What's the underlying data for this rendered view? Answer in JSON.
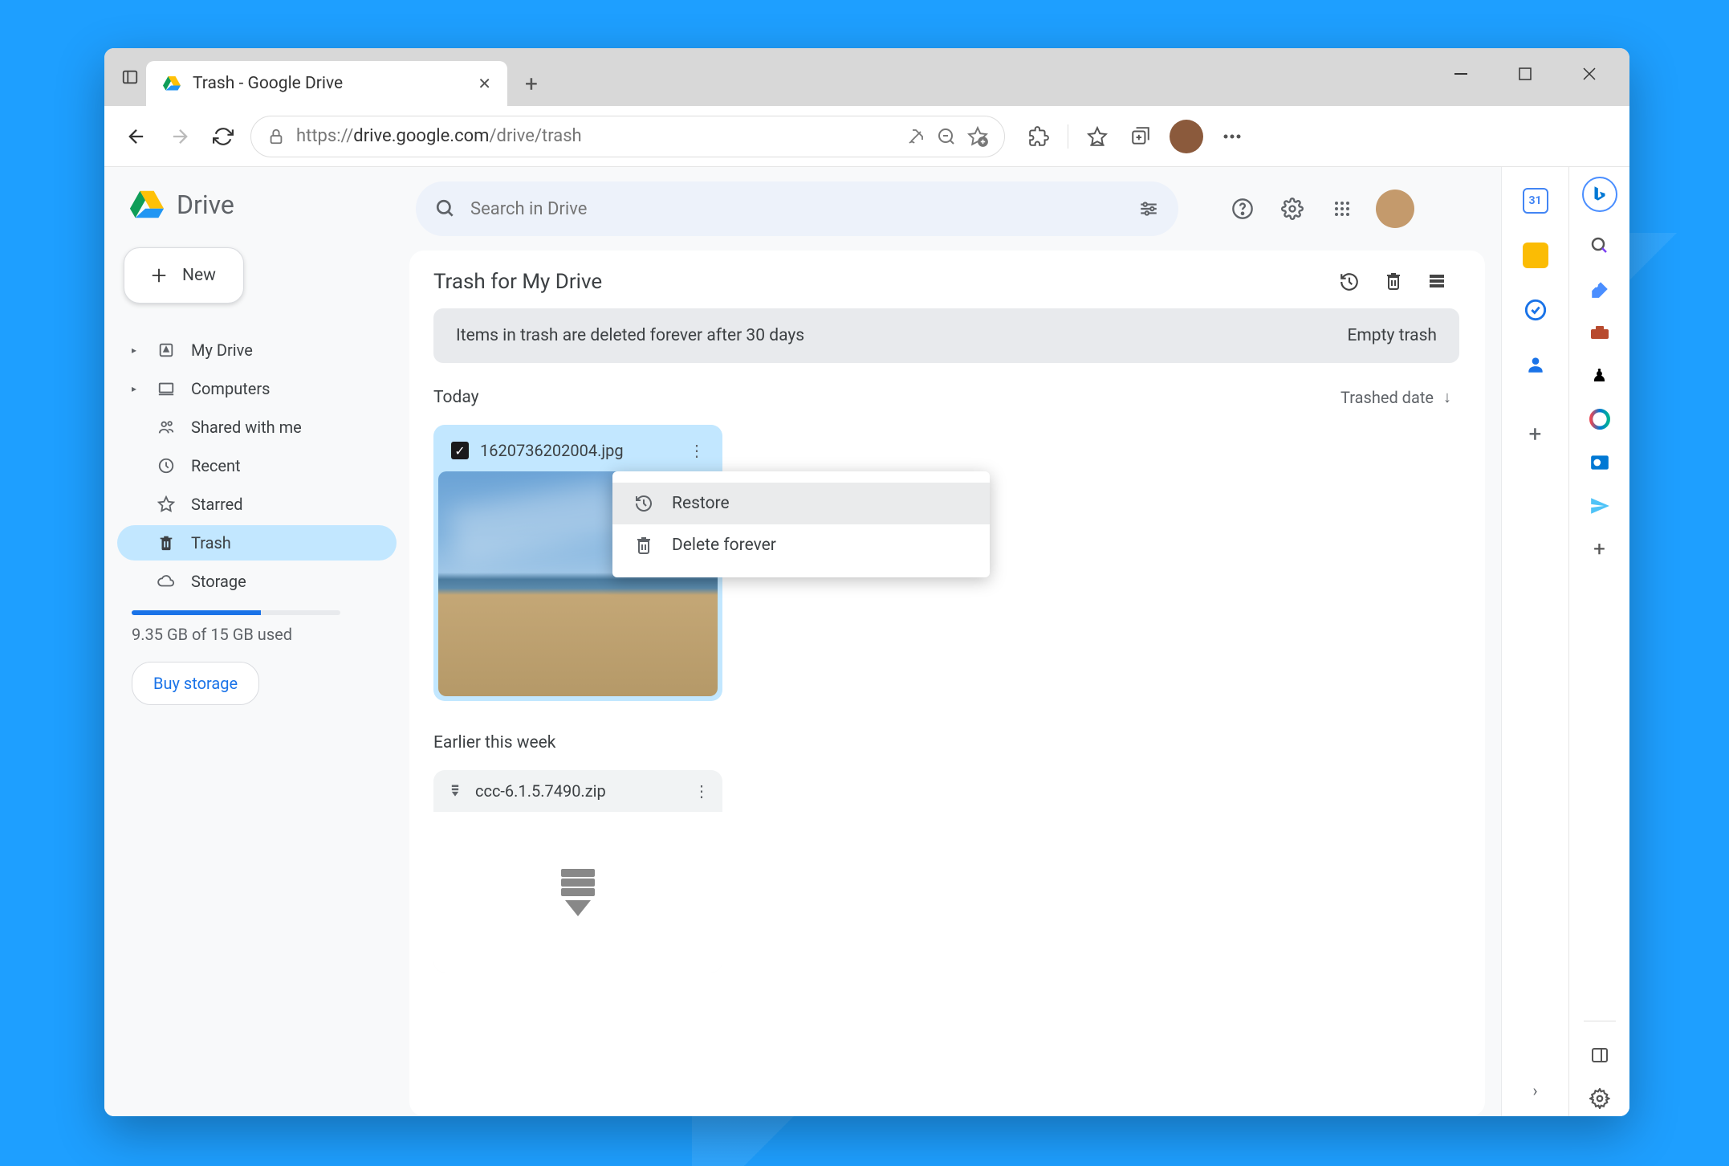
{
  "tab": {
    "title": "Trash - Google Drive"
  },
  "url": {
    "scheme": "https://",
    "host": "drive.google.com",
    "path": "/drive/trash"
  },
  "drive": {
    "logo_text": "Drive",
    "new_button": "New",
    "nav": {
      "my_drive": "My Drive",
      "computers": "Computers",
      "shared": "Shared with me",
      "recent": "Recent",
      "starred": "Starred",
      "trash": "Trash",
      "storage": "Storage"
    },
    "storage_text": "9.35 GB of 15 GB used",
    "buy_storage": "Buy storage",
    "search_placeholder": "Search in Drive"
  },
  "content": {
    "title": "Trash for My Drive",
    "banner_text": "Items in trash are deleted forever after 30 days",
    "empty_trash": "Empty trash",
    "sort_label": "Trashed date",
    "sections": {
      "today": "Today",
      "earlier_week": "Earlier this week"
    },
    "files": {
      "today": [
        {
          "name": "1620736202004.jpg",
          "selected": true
        }
      ],
      "earlier_week": [
        {
          "name": "ccc-6.1.5.7490.zip",
          "selected": false
        }
      ]
    }
  },
  "context_menu": {
    "restore": "Restore",
    "delete_forever": "Delete forever"
  }
}
